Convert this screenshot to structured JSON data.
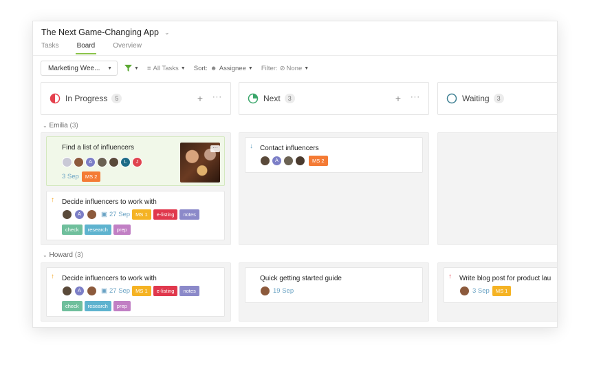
{
  "app": {
    "title": "The Next Game-Changing App"
  },
  "tabs": [
    {
      "label": "Tasks",
      "active": false
    },
    {
      "label": "Board",
      "active": true
    },
    {
      "label": "Overview",
      "active": false
    }
  ],
  "toolbar": {
    "view_select": "Marketing Wee...",
    "all_tasks": "All Tasks",
    "sort_label": "Sort:",
    "sort_value": "Assignee",
    "filter_label": "Filter:",
    "filter_value": "None"
  },
  "columns": [
    {
      "title": "In Progress",
      "count": "5",
      "color": "#e5414e"
    },
    {
      "title": "Next",
      "count": "3",
      "color": "#3aa66a"
    },
    {
      "title": "Waiting",
      "count": "3",
      "color": "#3d7f92"
    }
  ],
  "groups": [
    {
      "name": "Emilia",
      "count": "(3)"
    },
    {
      "name": "Howard",
      "count": "(3)"
    }
  ],
  "cards": {
    "e1": {
      "title": "Find a list of influencers",
      "date": "3 Sep",
      "tag": "MS 2"
    },
    "e2": {
      "title": "Decide influencers to work with",
      "date": "27 Sep",
      "tags": [
        "MS 1",
        "e-listing",
        "notes",
        "check",
        "research",
        "prep"
      ]
    },
    "e3": {
      "title": "Contact influencers",
      "tag": "MS 2"
    },
    "h1": {
      "title": "Decide influencers to work with",
      "date": "27 Sep",
      "tags": [
        "MS 1",
        "e-listing",
        "notes",
        "check",
        "research",
        "prep"
      ]
    },
    "h2": {
      "title": "Quick getting started guide",
      "date": "19 Sep"
    },
    "h3": {
      "title": "Write blog post for product lau",
      "date": "3 Sep",
      "tag": "MS 1"
    }
  },
  "avatar_letters": {
    "a": "A",
    "l": "L",
    "j": "J"
  },
  "colors": {
    "accent": "#8bc34a",
    "ms1": "#f5b324",
    "ms2": "#f47b35",
    "elisting": "#e0384d",
    "notes": "#8b89c9",
    "check": "#6fbf9c",
    "research": "#5eb3cf",
    "prep": "#c17fc4"
  }
}
